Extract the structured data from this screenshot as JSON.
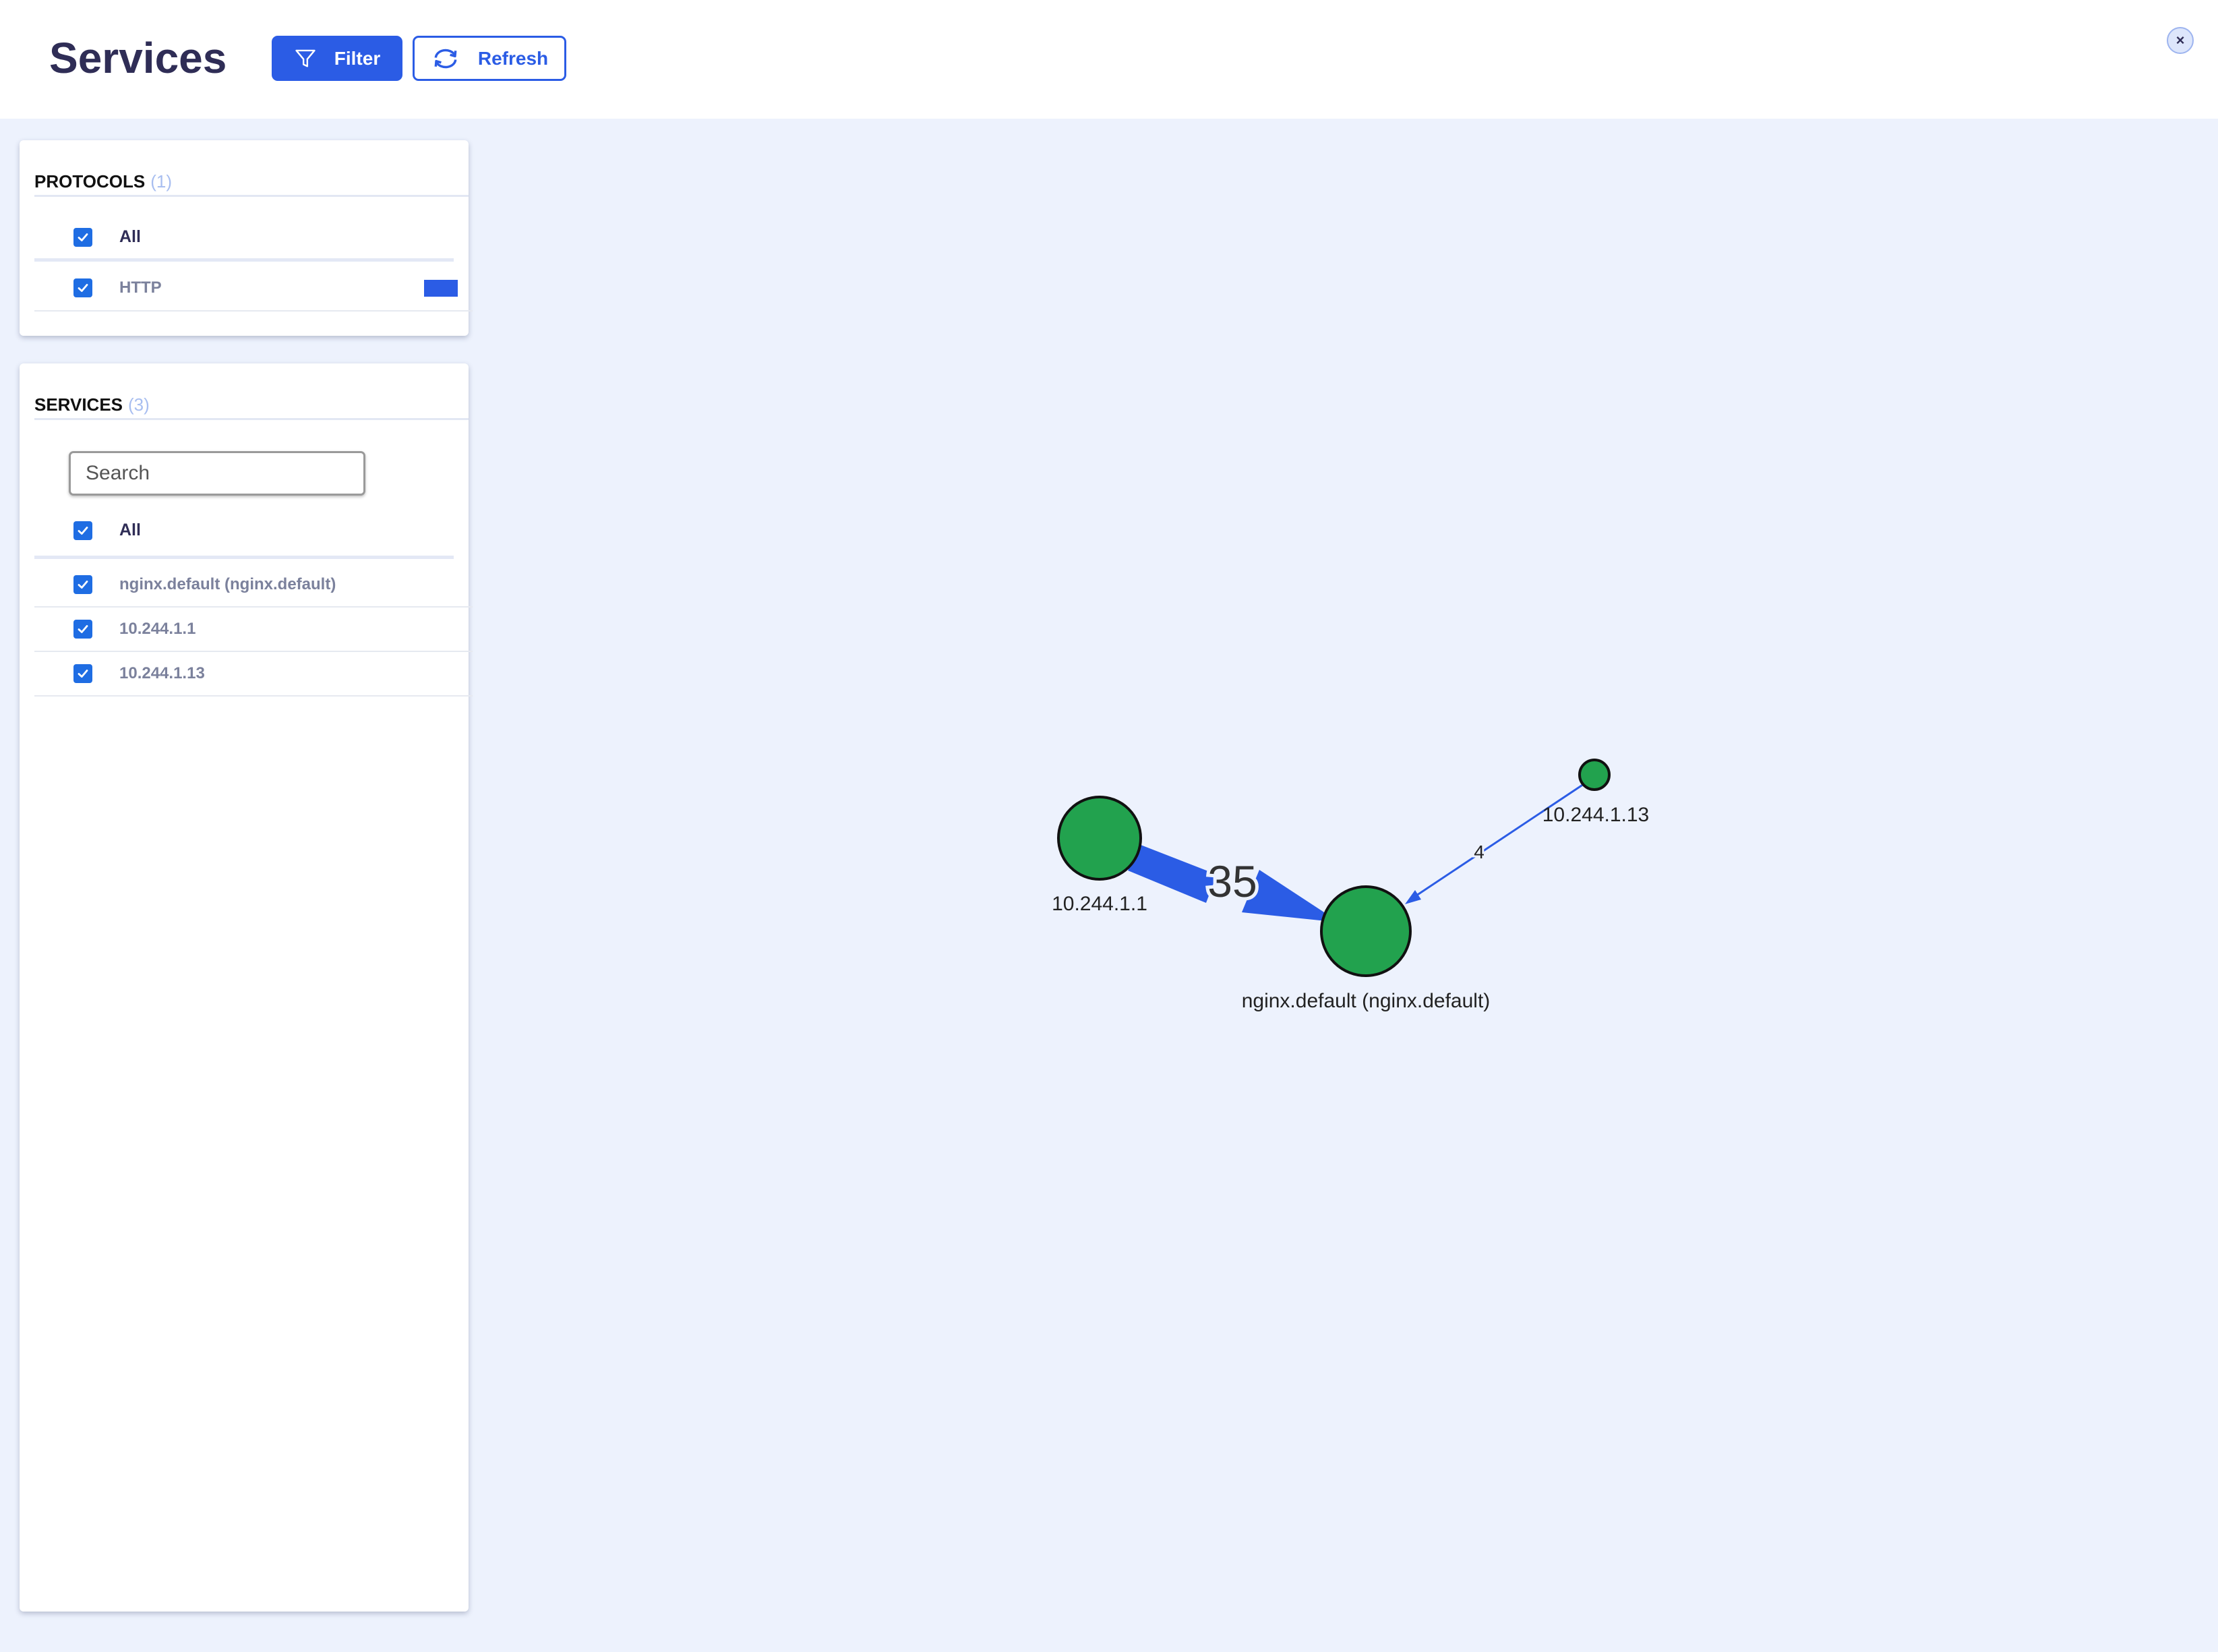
{
  "header": {
    "title": "Services",
    "filter_label": "Filter",
    "refresh_label": "Refresh",
    "close_label": "×"
  },
  "colors": {
    "accent": "#2b5ce5",
    "node_fill": "#22a24e",
    "background": "#edf2fd",
    "title": "#2f2d56"
  },
  "icons": {
    "filter": "funnel-icon",
    "refresh": "refresh-arrows-icon",
    "close": "close-icon",
    "checkbox": "checkmark-icon"
  },
  "protocols": {
    "heading": "PROTOCOLS",
    "count": "(1)",
    "all_label": "All",
    "all_checked": true,
    "items": [
      {
        "label": "HTTP",
        "checked": true,
        "color": "#2b5ce5"
      }
    ]
  },
  "services": {
    "heading": "SERVICES",
    "count": "(3)",
    "search_placeholder": "Search",
    "all_label": "All",
    "all_checked": true,
    "items": [
      {
        "label": "nginx.default (nginx.default)",
        "checked": true
      },
      {
        "label": "10.244.1.1",
        "checked": true
      },
      {
        "label": "10.244.1.13",
        "checked": true
      }
    ]
  },
  "graph": {
    "nodes": [
      {
        "id": "nginx",
        "label": "nginx.default (nginx.default)"
      },
      {
        "id": "n1",
        "label": "10.244.1.1"
      },
      {
        "id": "n13",
        "label": "10.244.1.13"
      }
    ],
    "edges": [
      {
        "from": "n1",
        "to": "nginx",
        "label": "35",
        "protocol": "HTTP"
      },
      {
        "from": "n13",
        "to": "nginx",
        "label": "4",
        "protocol": "HTTP"
      }
    ]
  }
}
